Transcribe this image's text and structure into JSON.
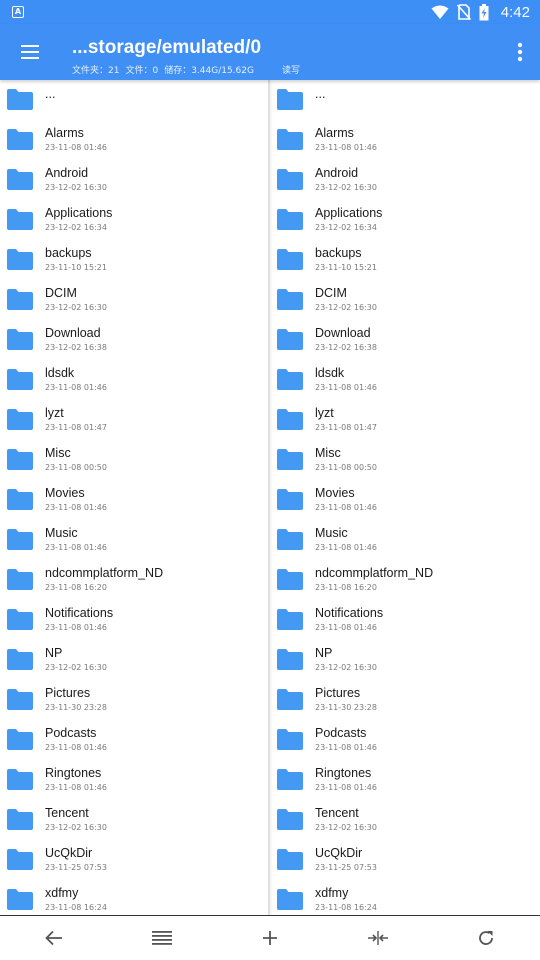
{
  "status_bar": {
    "time": "4:42",
    "app_badge": "A"
  },
  "app_bar": {
    "title": "...storage/emulated/0",
    "subtitle": {
      "folders": "文件夹：21",
      "files": "文件：0",
      "storage": "储存：3.44G/15.62G",
      "mode": "读写"
    }
  },
  "up_entry": "...",
  "panes": {
    "left": [
      {
        "name": "Alarms",
        "date": "23-11-08 01:46"
      },
      {
        "name": "Android",
        "date": "23-12-02 16:30"
      },
      {
        "name": "Applications",
        "date": "23-12-02 16:34"
      },
      {
        "name": "backups",
        "date": "23-11-10 15:21"
      },
      {
        "name": "DCIM",
        "date": "23-12-02 16:30"
      },
      {
        "name": "Download",
        "date": "23-12-02 16:38"
      },
      {
        "name": "ldsdk",
        "date": "23-11-08 01:46"
      },
      {
        "name": "lyzt",
        "date": "23-11-08 01:47"
      },
      {
        "name": "Misc",
        "date": "23-11-08 00:50"
      },
      {
        "name": "Movies",
        "date": "23-11-08 01:46"
      },
      {
        "name": "Music",
        "date": "23-11-08 01:46"
      },
      {
        "name": "ndcommplatform_ND",
        "date": "23-11-08 16:20"
      },
      {
        "name": "Notifications",
        "date": "23-11-08 01:46"
      },
      {
        "name": "NP",
        "date": "23-12-02 16:30"
      },
      {
        "name": "Pictures",
        "date": "23-11-30 23:28"
      },
      {
        "name": "Podcasts",
        "date": "23-11-08 01:46"
      },
      {
        "name": "Ringtones",
        "date": "23-11-08 01:46"
      },
      {
        "name": "Tencent",
        "date": "23-12-02 16:30"
      },
      {
        "name": "UcQkDir",
        "date": "23-11-25 07:53"
      },
      {
        "name": "xdfmy",
        "date": "23-11-08 16:24"
      }
    ],
    "right": [
      {
        "name": "Alarms",
        "date": "23-11-08 01:46"
      },
      {
        "name": "Android",
        "date": "23-12-02 16:30"
      },
      {
        "name": "Applications",
        "date": "23-12-02 16:34"
      },
      {
        "name": "backups",
        "date": "23-11-10 15:21"
      },
      {
        "name": "DCIM",
        "date": "23-12-02 16:30"
      },
      {
        "name": "Download",
        "date": "23-12-02 16:38"
      },
      {
        "name": "ldsdk",
        "date": "23-11-08 01:46"
      },
      {
        "name": "lyzt",
        "date": "23-11-08 01:47"
      },
      {
        "name": "Misc",
        "date": "23-11-08 00:50"
      },
      {
        "name": "Movies",
        "date": "23-11-08 01:46"
      },
      {
        "name": "Music",
        "date": "23-11-08 01:46"
      },
      {
        "name": "ndcommplatform_ND",
        "date": "23-11-08 16:20"
      },
      {
        "name": "Notifications",
        "date": "23-11-08 01:46"
      },
      {
        "name": "NP",
        "date": "23-12-02 16:30"
      },
      {
        "name": "Pictures",
        "date": "23-11-30 23:28"
      },
      {
        "name": "Podcasts",
        "date": "23-11-08 01:46"
      },
      {
        "name": "Ringtones",
        "date": "23-11-08 01:46"
      },
      {
        "name": "Tencent",
        "date": "23-12-02 16:30"
      },
      {
        "name": "UcQkDir",
        "date": "23-11-25 07:53"
      },
      {
        "name": "xdfmy",
        "date": "23-11-08 16:24"
      }
    ]
  },
  "toolbar": [
    "back-arrow-icon",
    "list-menu-icon",
    "add-icon",
    "swap-panes-icon",
    "refresh-icon"
  ],
  "colors": {
    "accent": "#3f8ff5",
    "folder": "#4499f3"
  }
}
